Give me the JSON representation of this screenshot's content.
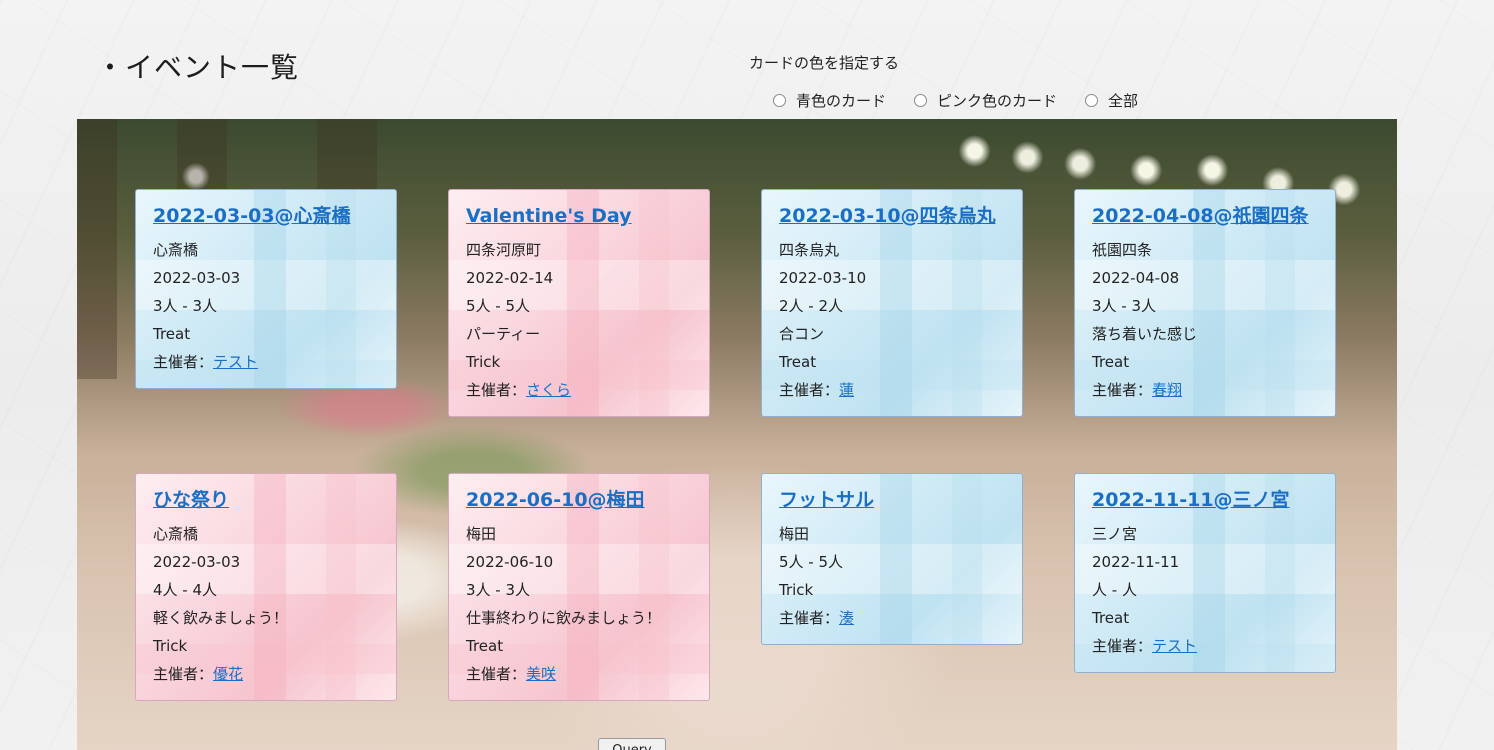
{
  "page_title": "・イベント一覧",
  "color_filter": {
    "label": "カードの色を指定する",
    "options": [
      "青色のカード",
      "ピンク色のカード",
      "全部"
    ]
  },
  "host_prefix": "主催者：",
  "events": [
    {
      "color": "blue",
      "title": "2022-03-03@心斎橋",
      "lines": [
        "心斎橋",
        "2022-03-03",
        "3人 - 3人",
        "Treat"
      ],
      "host": "テスト"
    },
    {
      "color": "pink",
      "title": "Valentine's Day",
      "lines": [
        "四条河原町",
        "2022-02-14",
        "5人 - 5人",
        "パーティー",
        "Trick"
      ],
      "host": "さくら"
    },
    {
      "color": "blue",
      "title": "2022-03-10@四条烏丸",
      "lines": [
        "四条烏丸",
        "2022-03-10",
        "2人 - 2人",
        "合コン",
        "Treat"
      ],
      "host": "蓮"
    },
    {
      "color": "blue",
      "title": "2022-04-08@祇園四条",
      "lines": [
        "祇園四条",
        "2022-04-08",
        "3人 - 3人",
        "落ち着いた感じ",
        "Treat"
      ],
      "host": "春翔"
    },
    {
      "color": "pink",
      "title": "ひな祭り",
      "lines": [
        "心斎橋",
        "2022-03-03",
        "4人 - 4人",
        "軽く飲みましょう！",
        "Trick"
      ],
      "host": "優花"
    },
    {
      "color": "pink",
      "title": "2022-06-10@梅田",
      "lines": [
        "梅田",
        "2022-06-10",
        "3人 - 3人",
        "仕事終わりに飲みましょう！",
        "Treat"
      ],
      "host": "美咲"
    },
    {
      "color": "blue",
      "title": "フットサル",
      "lines": [
        "梅田",
        "5人 - 5人",
        "Trick"
      ],
      "host": "湊"
    },
    {
      "color": "blue",
      "title": "2022-11-11@三ノ宮",
      "lines": [
        "三ノ宮",
        "2022-11-11",
        "人 - 人",
        "Treat"
      ],
      "host": "テスト"
    }
  ],
  "query_button": "Query"
}
